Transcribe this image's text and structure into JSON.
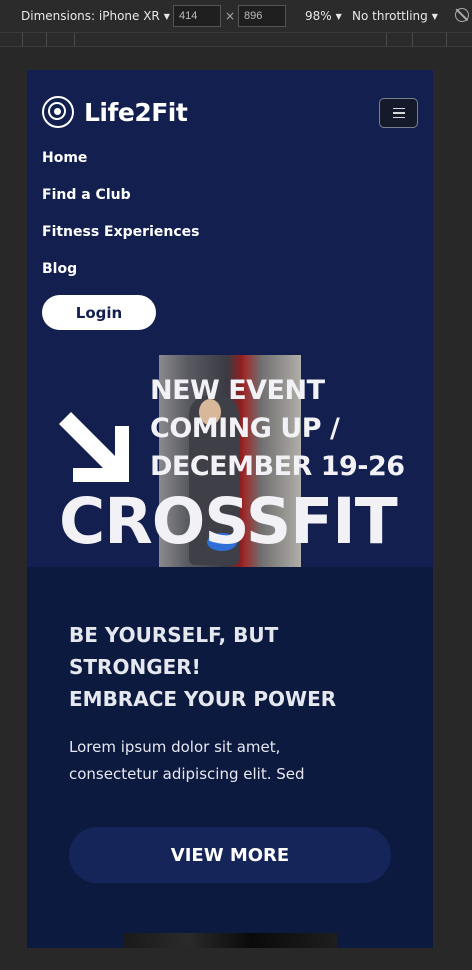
{
  "devtools": {
    "device_label": "Dimensions: iPhone XR",
    "width_value": "414",
    "height_value": "896",
    "times_sign": "×",
    "zoom": "98%",
    "throttling": "No throttling",
    "caret": "▼"
  },
  "site": {
    "brand": "Life2Fit",
    "nav": [
      "Home",
      "Find a Club",
      "Fitness Experiences",
      "Blog"
    ],
    "login_label": "Login",
    "event_title": "NEW EVENT COMING UP / DECEMBER 19-26",
    "big_title": "CROSSFIT",
    "tagline_line1": "BE YOURSELF, BUT STRONGER!",
    "tagline_line2": "EMBRACE YOUR POWER",
    "lorem": "Lorem ipsum dolor sit amet, consectetur adipiscing elit. Sed",
    "view_more_label": "VIEW MORE"
  },
  "colors": {
    "hero_bg": "#121f4f",
    "section_bg": "#0d1a3f",
    "button_bg": "#15255a"
  }
}
